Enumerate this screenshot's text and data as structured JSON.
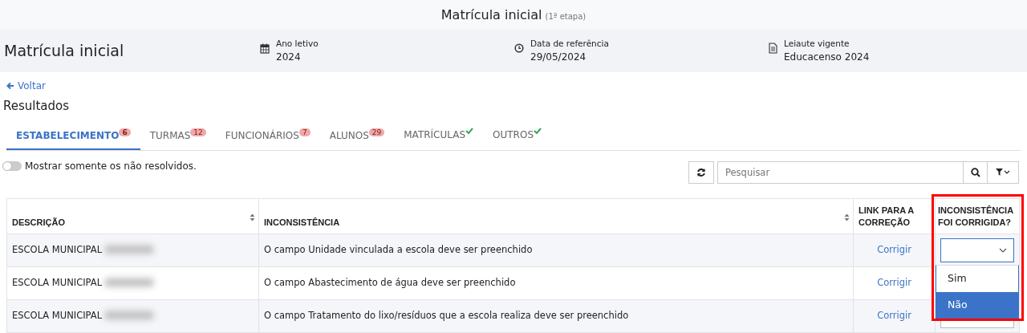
{
  "top_bar": {
    "title": "Matrícula inicial",
    "subtitle": "(1ª etapa)"
  },
  "header": {
    "title": "Matrícula inicial",
    "info": [
      {
        "label": "Ano letivo",
        "value": "2024"
      },
      {
        "label": "Data de referência",
        "value": "29/05/2024"
      },
      {
        "label": "Leiaute vigente",
        "value": "Educacenso 2024"
      }
    ]
  },
  "back_link": "Voltar",
  "section_title": "Resultados",
  "tabs": [
    {
      "label": "ESTABELECIMENTO",
      "badge": "6",
      "selected": true,
      "complete": false
    },
    {
      "label": "TURMAS",
      "badge": "12",
      "selected": false,
      "complete": false
    },
    {
      "label": "FUNCIONÁRIOS",
      "badge": "7",
      "selected": false,
      "complete": false
    },
    {
      "label": "ALUNOS",
      "badge": "29",
      "selected": false,
      "complete": false
    },
    {
      "label": "MATRÍCULAS",
      "selected": false,
      "complete": true
    },
    {
      "label": "OUTROS",
      "selected": false,
      "complete": true
    }
  ],
  "toggle": {
    "label": "Mostrar somente os não resolvidos.",
    "on": false
  },
  "search": {
    "placeholder": "Pesquisar"
  },
  "table": {
    "columns": [
      {
        "label": "DESCRIÇÃO",
        "sortable": true,
        "highlighted": false
      },
      {
        "label": "INCONSISTÊNCIA",
        "sortable": true,
        "highlighted": false
      },
      {
        "label": "LINK PARA A CORREÇÃO",
        "sortable": false,
        "highlighted": false
      },
      {
        "label": "INCONSISTÊNCIA FOI CORRIGIDA?",
        "sortable": false,
        "highlighted": true
      }
    ],
    "rows": [
      {
        "description": "ESCOLA MUNICIPAL",
        "redacted": true,
        "inconsistency": "O campo Unidade vinculada a escola deve ser preenchido",
        "link": "Corrigir",
        "expanded": true
      },
      {
        "description": "ESCOLA MUNICIPAL",
        "redacted": true,
        "inconsistency": "O campo Abastecimento de água deve ser preenchido",
        "link": "Corrigir",
        "expanded": false
      },
      {
        "description": "ESCOLA MUNICIPAL",
        "redacted": true,
        "inconsistency": "O campo Tratamento do lixo/resíduos que a escola realiza deve ser preenchido",
        "link": "Corrigir",
        "expanded": false
      }
    ]
  },
  "dropdown": {
    "options": [
      {
        "label": "Sim",
        "selected": false
      },
      {
        "label": "Não",
        "selected": true
      }
    ]
  }
}
